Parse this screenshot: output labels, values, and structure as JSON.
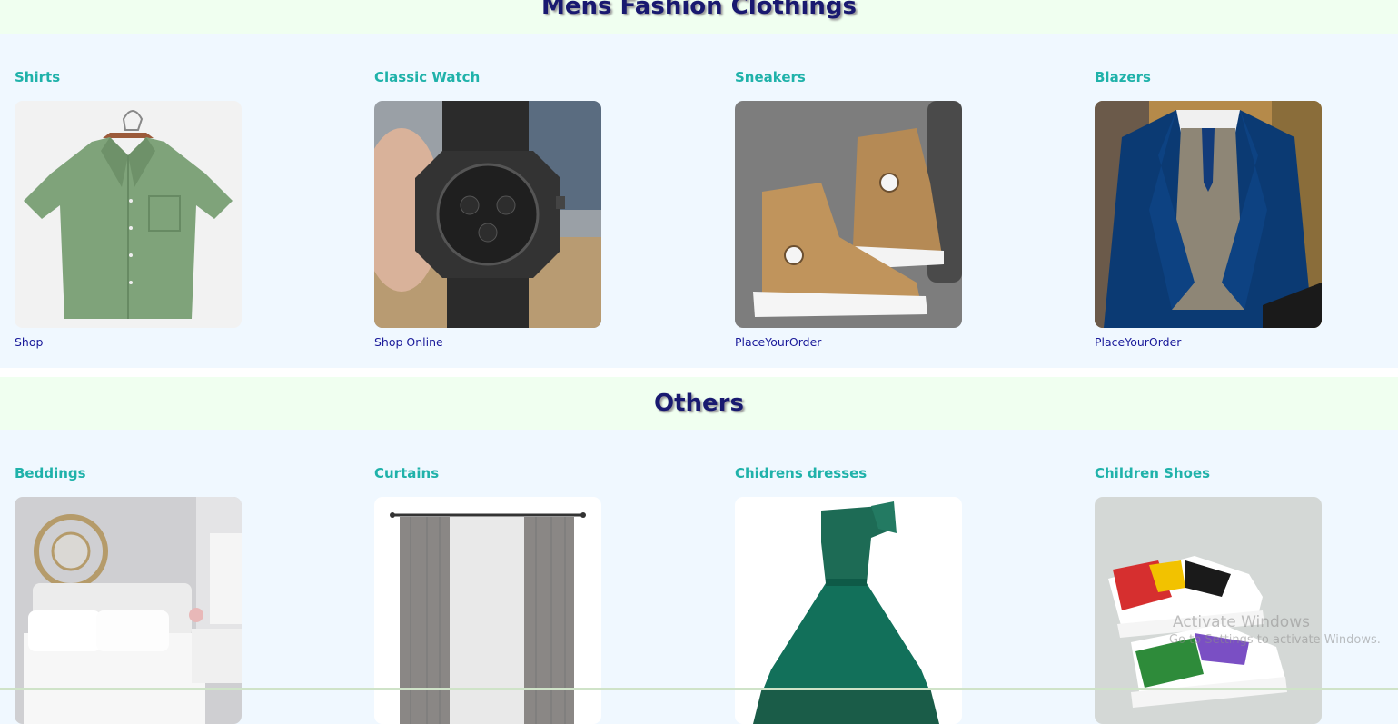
{
  "sections": {
    "mens": {
      "title": "Mens Fashion Clothings",
      "cards": [
        {
          "title": "Shirts",
          "link": "Shop",
          "image": "green-shirt-image"
        },
        {
          "title": "Classic Watch",
          "link": "Shop Online",
          "image": "black-watch-image"
        },
        {
          "title": "Sneakers",
          "link": "PlaceYourOrder",
          "image": "brown-sneakers-image"
        },
        {
          "title": "Blazers",
          "link": "PlaceYourOrder",
          "image": "blue-blazer-image"
        }
      ]
    },
    "others": {
      "title": "Others",
      "cards": [
        {
          "title": "Beddings",
          "image": "bedroom-image"
        },
        {
          "title": "Curtains",
          "image": "grey-curtains-image"
        },
        {
          "title": "Chidrens dresses",
          "image": "green-dress-image"
        },
        {
          "title": "Children Shoes",
          "image": "painted-sneakers-image"
        }
      ]
    }
  },
  "watermark": {
    "line1": "Activate Windows",
    "line2": "Go to Settings to activate Windows."
  },
  "colors": {
    "header_bg": "#f0fff0",
    "body_bg": "#f0f8ff",
    "heading": "#191970",
    "card_title": "#20b2aa",
    "link": "#1a1a9a"
  }
}
